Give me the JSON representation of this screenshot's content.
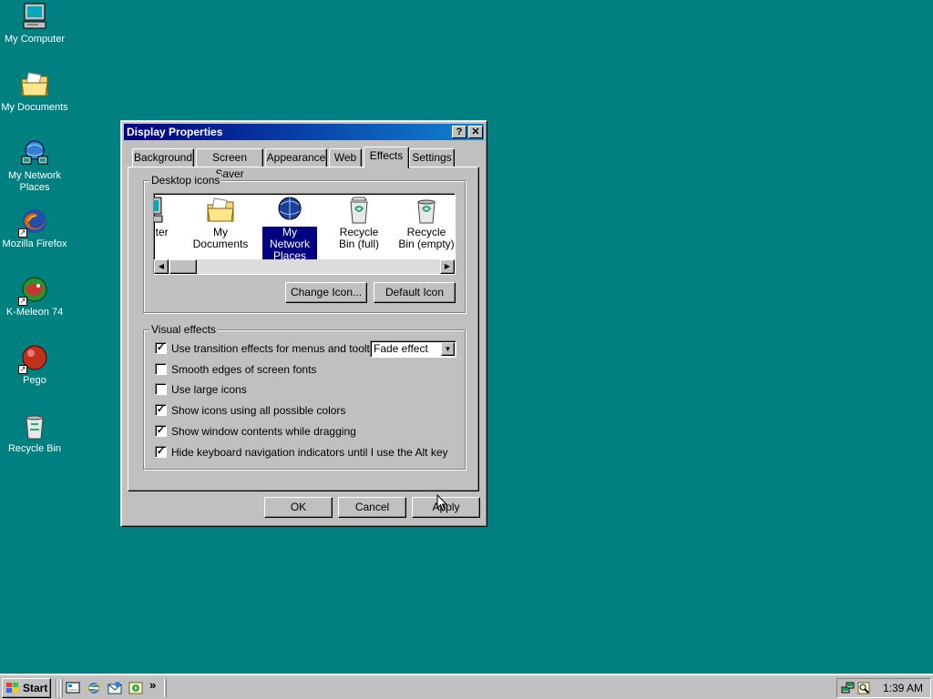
{
  "desktop": {
    "icons": [
      {
        "label": "My Computer",
        "icon": "computer-icon"
      },
      {
        "label": "My Documents",
        "icon": "folder-icon"
      },
      {
        "label": "My Network Places",
        "icon": "network-icon"
      },
      {
        "label": "Mozilla Firefox",
        "icon": "firefox-icon"
      },
      {
        "label": "K-Meleon 74",
        "icon": "kmeleon-icon"
      },
      {
        "label": "Pego",
        "icon": "pego-icon"
      },
      {
        "label": "Recycle Bin",
        "icon": "recycle-bin-icon"
      }
    ]
  },
  "window": {
    "title": "Display Properties",
    "help_glyph": "?",
    "close_glyph": "✕",
    "tabs": [
      {
        "label": "Background"
      },
      {
        "label": "Screen Saver"
      },
      {
        "label": "Appearance"
      },
      {
        "label": "Web"
      },
      {
        "label": "Effects",
        "active": true
      },
      {
        "label": "Settings"
      }
    ],
    "desktop_icons_group": {
      "title": "Desktop icons",
      "items": [
        {
          "label": "mputer"
        },
        {
          "label": "My Documents"
        },
        {
          "label": "My Network Places",
          "selected": true
        },
        {
          "label": "Recycle Bin (full)"
        },
        {
          "label": "Recycle Bin (empty)"
        }
      ],
      "change_icon": "Change Icon...",
      "default_icon": "Default Icon"
    },
    "visual_effects_group": {
      "title": "Visual effects",
      "options": [
        {
          "label": "Use transition effects for menus and tooltips",
          "checked": true
        },
        {
          "label": "Smooth edges of screen fonts",
          "checked": false
        },
        {
          "label": "Use large icons",
          "checked": false
        },
        {
          "label": "Show icons using all possible colors",
          "checked": true
        },
        {
          "label": "Show window contents while dragging",
          "checked": true
        },
        {
          "label": "Hide keyboard navigation indicators until I use the Alt key",
          "checked": true
        }
      ],
      "transition_effect": "Fade effect"
    },
    "buttons": {
      "ok": "OK",
      "cancel": "Cancel",
      "apply": "Apply"
    }
  },
  "taskbar": {
    "start_label": "Start",
    "overflow_glyph": "»",
    "clock": "1:39 AM"
  },
  "colors": {
    "desktop": "#008080",
    "selection": "#000080",
    "face": "#c0c0c0"
  }
}
